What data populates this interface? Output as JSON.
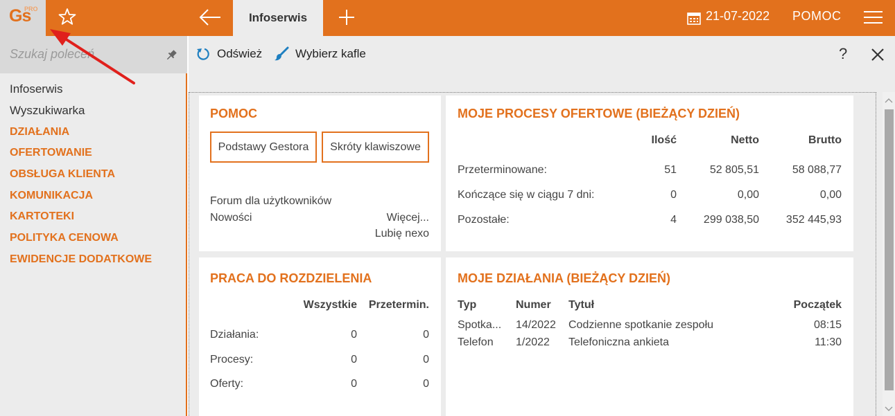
{
  "topbar": {
    "logo_text": "Gs",
    "logo_badge": "PRO",
    "active_tab": "Infoserwis",
    "date": "21-07-2022",
    "help_label": "POMOC",
    "accent_color": "#e2711d"
  },
  "sidebar": {
    "search_placeholder": "Szukaj poleceń",
    "items": [
      {
        "label": "Infoserwis",
        "kind": "plain"
      },
      {
        "label": "Wyszukiwarka",
        "kind": "plain"
      },
      {
        "label": "DZIAŁANIA",
        "kind": "category"
      },
      {
        "label": "OFERTOWANIE",
        "kind": "category"
      },
      {
        "label": "OBSŁUGA KLIENTA",
        "kind": "category"
      },
      {
        "label": "KOMUNIKACJA",
        "kind": "category"
      },
      {
        "label": "KARTOTEKI",
        "kind": "category"
      },
      {
        "label": "POLITYKA CENOWA",
        "kind": "category"
      },
      {
        "label": "EWIDENCJE DODATKOWE",
        "kind": "category"
      }
    ]
  },
  "toolbar": {
    "refresh_label": "Odśwież",
    "tiles_label": "Wybierz kafle",
    "help_symbol": "?"
  },
  "tiles": {
    "pomoc": {
      "title": "POMOC",
      "btn_basics": "Podstawy Gestora",
      "btn_shortcuts": "Skróty klawiszowe",
      "link_forum": "Forum dla użytkowników",
      "link_news": "Nowości",
      "link_more": "Więcej...",
      "link_like": "Lubię nexo"
    },
    "offers": {
      "title": "MOJE PROCESY OFERTOWE (BIEŻĄCY DZIEŃ)",
      "headers": {
        "count": "Ilość",
        "net": "Netto",
        "gross": "Brutto"
      },
      "rows": [
        {
          "label": "Przeterminowane:",
          "count": "51",
          "net": "52 805,51",
          "gross": "58 088,77"
        },
        {
          "label": "Kończące się w ciągu 7 dni:",
          "count": "0",
          "net": "0,00",
          "gross": "0,00"
        },
        {
          "label": "Pozostałe:",
          "count": "4",
          "net": "299 038,50",
          "gross": "352 445,93"
        }
      ]
    },
    "work": {
      "title": "PRACA DO ROZDZIELENIA",
      "headers": {
        "all": "Wszystkie",
        "overdue": "Przetermin."
      },
      "rows": [
        {
          "label": "Działania:",
          "all": "0",
          "overdue": "0"
        },
        {
          "label": "Procesy:",
          "all": "0",
          "overdue": "0"
        },
        {
          "label": "Oferty:",
          "all": "0",
          "overdue": "0"
        }
      ]
    },
    "actions": {
      "title": "MOJE DZIAŁANIA (BIEŻĄCY DZIEŃ)",
      "headers": {
        "type": "Typ",
        "number": "Numer",
        "title": "Tytuł",
        "start": "Początek"
      },
      "rows": [
        {
          "type": "Spotka...",
          "number": "14/2022",
          "title": "Codzienne spotkanie zespołu",
          "start": "08:15"
        },
        {
          "type": "Telefon",
          "number": "1/2022",
          "title": "Telefoniczna ankieta",
          "start": "11:30"
        }
      ]
    }
  }
}
